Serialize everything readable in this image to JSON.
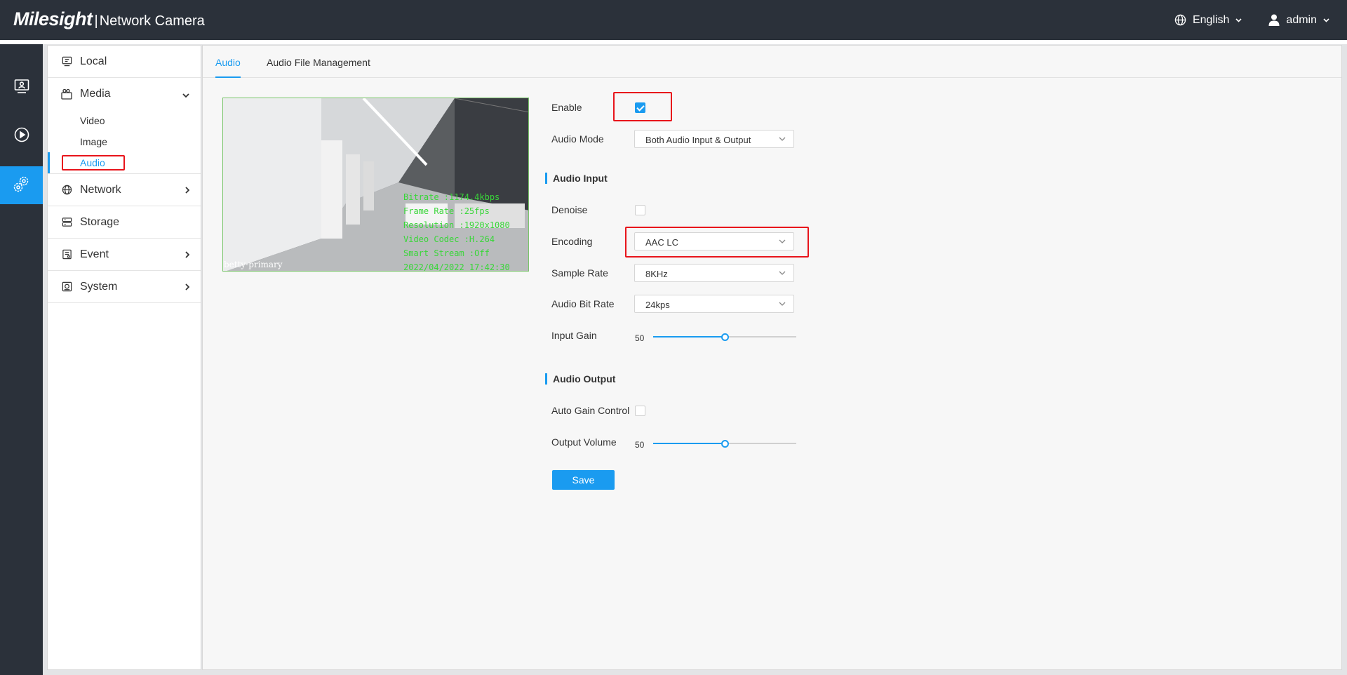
{
  "header": {
    "brand": "Milesight",
    "separator": "|",
    "product": "Network Camera",
    "language": "English",
    "user": "admin"
  },
  "rail": {
    "items": [
      {
        "icon": "live-view-icon"
      },
      {
        "icon": "playback-icon"
      },
      {
        "icon": "settings-icon",
        "active": true
      }
    ]
  },
  "sidebar": {
    "local": "Local",
    "media": "Media",
    "media_sub": [
      "Video",
      "Image",
      "Audio"
    ],
    "network": "Network",
    "storage": "Storage",
    "event": "Event",
    "system": "System"
  },
  "tabs": [
    "Audio",
    "Audio File Management"
  ],
  "preview": {
    "osd_lines": [
      "Bitrate :1174.4kbps",
      "Frame Rate :25fps",
      "Resolution :1920x1080",
      "Video Codec :H.264",
      "Smart Stream :Off",
      "2022/04/2022 17:42:30"
    ],
    "channel_name": "betty-primary"
  },
  "form": {
    "enable": {
      "label": "Enable",
      "checked": true
    },
    "audio_mode": {
      "label": "Audio Mode",
      "value": "Both Audio Input & Output"
    },
    "audio_input_title": "Audio Input",
    "denoise": {
      "label": "Denoise",
      "checked": false
    },
    "encoding": {
      "label": "Encoding",
      "value": "AAC LC"
    },
    "sample_rate": {
      "label": "Sample Rate",
      "value": "8KHz"
    },
    "audio_bit_rate": {
      "label": "Audio Bit Rate",
      "value": "24kps"
    },
    "input_gain": {
      "label": "Input Gain",
      "value": "50",
      "level": 0.5
    },
    "audio_output_title": "Audio Output",
    "auto_gain": {
      "label": "Auto Gain Control",
      "checked": false
    },
    "output_volume": {
      "label": "Output Volume",
      "value": "50",
      "level": 0.5
    },
    "save": "Save"
  },
  "colors": {
    "accent": "#1a9bf0",
    "header_bg": "#2b313a",
    "highlight": "#e8141b",
    "osd_text": "#39d639"
  }
}
